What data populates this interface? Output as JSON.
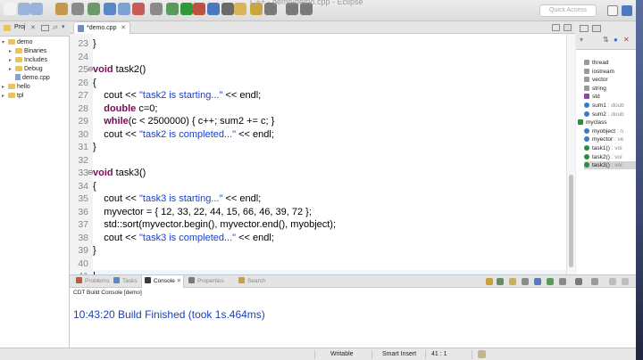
{
  "toolbar": {
    "title_ghost": "C++ - demo/demo.cpp - Eclipse",
    "quick_access_placeholder": "Quick Access"
  },
  "explorer": {
    "tab_label": "Proj",
    "tree": [
      {
        "label": "demo",
        "depth": 0,
        "expanded": true,
        "kind": "project"
      },
      {
        "label": "Binaries",
        "depth": 1,
        "expanded": false,
        "kind": "folder"
      },
      {
        "label": "Includes",
        "depth": 1,
        "expanded": false,
        "kind": "folder"
      },
      {
        "label": "Debug",
        "depth": 1,
        "expanded": false,
        "kind": "folder"
      },
      {
        "label": "demo.cpp",
        "depth": 1,
        "expanded": false,
        "kind": "file"
      },
      {
        "label": "hello",
        "depth": 0,
        "expanded": false,
        "kind": "project"
      },
      {
        "label": "tpl",
        "depth": 0,
        "expanded": false,
        "kind": "project"
      }
    ]
  },
  "editor": {
    "tab_label": "*demo.cpp",
    "lines": [
      {
        "n": "23",
        "text": "}"
      },
      {
        "n": "24",
        "text": ""
      },
      {
        "n": "25",
        "text": "void task2()"
      },
      {
        "n": "26",
        "text": "{"
      },
      {
        "n": "27",
        "text": "    cout << \"task2 is starting...\" << endl;"
      },
      {
        "n": "28",
        "text": "    double c=0;"
      },
      {
        "n": "29",
        "text": "    while(c < 2500000) { c++; sum2 += c; }"
      },
      {
        "n": "30",
        "text": "    cout << \"task2 is completed...\" << endl;"
      },
      {
        "n": "31",
        "text": "}"
      },
      {
        "n": "32",
        "text": ""
      },
      {
        "n": "33",
        "text": "void task3()"
      },
      {
        "n": "34",
        "text": "{"
      },
      {
        "n": "35",
        "text": "    cout << \"task3 is starting...\" << endl;"
      },
      {
        "n": "36",
        "text": "    myvector = { 12, 33, 22, 44, 15, 66, 46, 39, 72 };"
      },
      {
        "n": "37",
        "text": "    std::sort(myvector.begin(), myvector.end(), myobject);"
      },
      {
        "n": "38",
        "text": "    cout << \"task3 is completed...\" << endl;"
      },
      {
        "n": "39",
        "text": "}"
      },
      {
        "n": "40",
        "text": ""
      },
      {
        "n": "41",
        "text": ""
      }
    ]
  },
  "outline": {
    "items": [
      {
        "name": "thread",
        "detail": "",
        "icon": "include-icon",
        "selected": false
      },
      {
        "name": "iostream",
        "detail": "",
        "icon": "include-icon",
        "selected": false
      },
      {
        "name": "vector",
        "detail": "",
        "icon": "include-icon",
        "selected": false
      },
      {
        "name": "string",
        "detail": "",
        "icon": "include-icon",
        "selected": false
      },
      {
        "name": "std",
        "detail": "",
        "icon": "namespace-icon",
        "selected": false
      },
      {
        "name": "sum1",
        "detail": " : doub",
        "icon": "variable-icon",
        "selected": false
      },
      {
        "name": "sum2",
        "detail": " : doub",
        "icon": "variable-icon",
        "selected": false
      },
      {
        "name": "myclass",
        "detail": "",
        "icon": "class-icon",
        "selected": false
      },
      {
        "name": "myobject",
        "detail": " : n",
        "icon": "variable-icon",
        "selected": false
      },
      {
        "name": "myector",
        "detail": " : ve",
        "icon": "variable-icon",
        "selected": false
      },
      {
        "name": "task1()",
        "detail": " : voi",
        "icon": "function-icon",
        "selected": false
      },
      {
        "name": "task2()",
        "detail": " : voi",
        "icon": "function-icon",
        "selected": false
      },
      {
        "name": "task3()",
        "detail": " : voi",
        "icon": "function-icon",
        "selected": true
      }
    ]
  },
  "console": {
    "tabs": [
      {
        "label": "Problems",
        "active": false
      },
      {
        "label": "Tasks",
        "active": false
      },
      {
        "label": "Console",
        "active": true
      },
      {
        "label": "Properties",
        "active": false
      },
      {
        "label": "Search",
        "active": false
      }
    ],
    "subtitle": "CDT Build Console [demo]",
    "output": "10:43:20 Build Finished (took 1s.464ms)"
  },
  "status": {
    "writable": "Writable",
    "insert_mode": "Smart Insert",
    "position": "41 : 1"
  },
  "colors": {
    "keyword": "#7a0a55",
    "string": "#1b3fcd",
    "console_output": "#1c3fb8",
    "current_line": "#eef5fc"
  }
}
